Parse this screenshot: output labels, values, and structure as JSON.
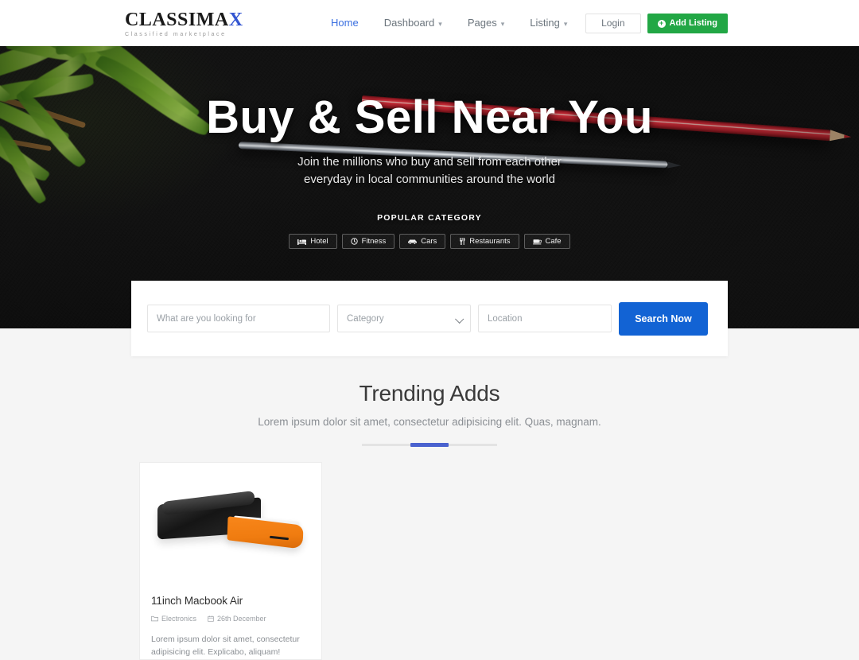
{
  "header": {
    "logo_main": "CLASSIMA",
    "logo_accent": "X",
    "logo_sub": "Classified marketplace",
    "nav": [
      {
        "label": "Home",
        "has_caret": false,
        "active": true
      },
      {
        "label": "Dashboard",
        "has_caret": true,
        "active": false
      },
      {
        "label": "Pages",
        "has_caret": true,
        "active": false
      },
      {
        "label": "Listing",
        "has_caret": true,
        "active": false
      }
    ],
    "login_label": "Login",
    "add_listing_label": "Add Listing",
    "add_listing_color": "#22a745",
    "active_nav_color": "#3a6fe0"
  },
  "hero": {
    "title": "Buy & Sell Near You",
    "subtitle_line1": "Join the millions who buy and sell from each other",
    "subtitle_line2": "everyday in local communities around the world",
    "popular_category_label": "POPULAR CATEGORY",
    "categories": [
      {
        "label": "Hotel",
        "icon": "bed-icon"
      },
      {
        "label": "Fitness",
        "icon": "dumbbell-icon"
      },
      {
        "label": "Cars",
        "icon": "car-icon"
      },
      {
        "label": "Restaurants",
        "icon": "utensils-icon"
      },
      {
        "label": "Cafe",
        "icon": "coffee-icon"
      }
    ]
  },
  "search": {
    "keyword_placeholder": "What are you looking for",
    "keyword_value": "",
    "category_selected": "Category",
    "category_options": [
      "Category"
    ],
    "location_placeholder": "Location",
    "location_value": "",
    "button_label": "Search Now",
    "button_color": "#1263d4"
  },
  "trending": {
    "title": "Trending Adds",
    "subtitle": "Lorem ipsum dolor sit amet, consectetur adipisicing elit. Quas, magnam.",
    "divider_color": "#4a62cf",
    "cards": [
      {
        "title": "11inch Macbook Air",
        "category": "Electronics",
        "category_icon": "folder-icon",
        "date": "26th December",
        "date_icon": "calendar-icon",
        "description": "Lorem ipsum dolor sit amet, consectetur adipisicing elit. Explicabo, aliquam!",
        "image": "laptop-sleeve-photo"
      }
    ]
  }
}
